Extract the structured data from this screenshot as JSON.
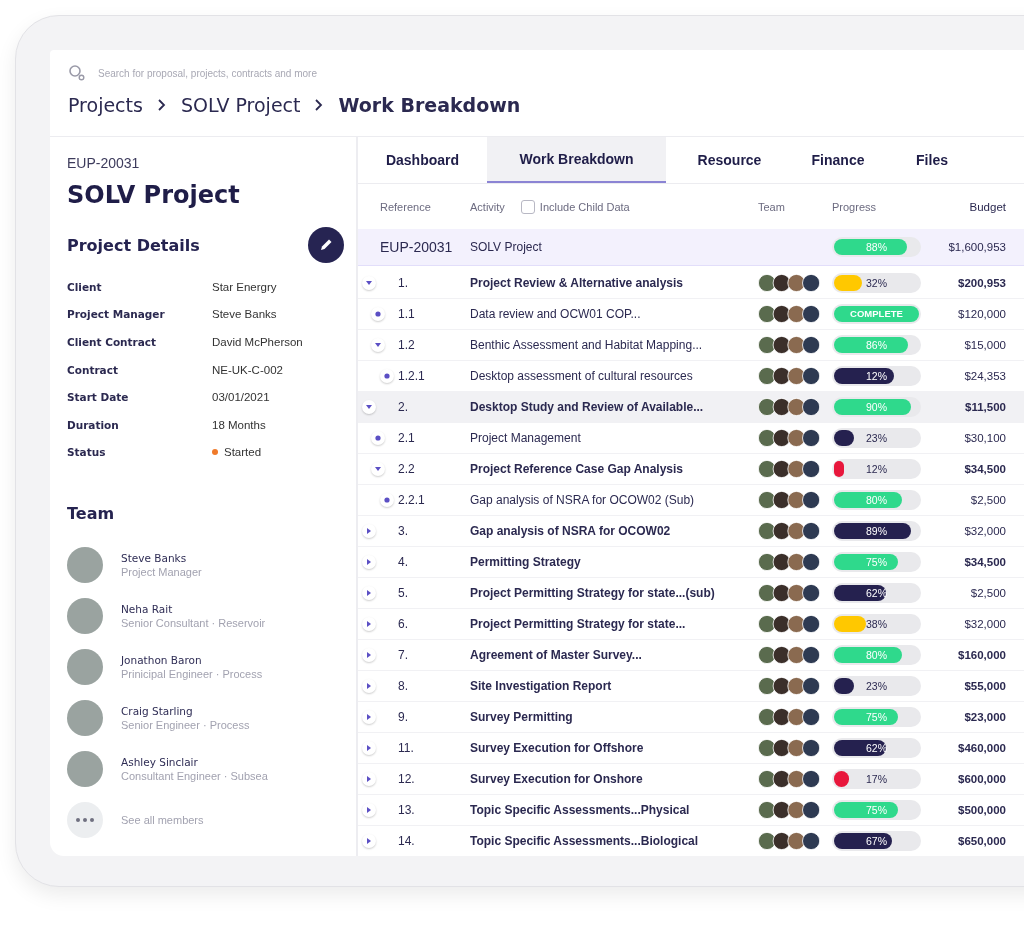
{
  "search": {
    "placeholder": "Search for proposal, projects, contracts and more"
  },
  "breadcrumb": [
    {
      "label": "Projects",
      "selected": false
    },
    {
      "label": "SOLV Project",
      "selected": false
    },
    {
      "label": "Work Breakdown",
      "selected": true
    }
  ],
  "project": {
    "reference": "EUP-20031",
    "title": "SOLV Project"
  },
  "details": {
    "title": "Project Details",
    "fields": [
      {
        "label": "Client",
        "value": "Star Energry"
      },
      {
        "label": "Project Manager",
        "value": "Steve Banks"
      },
      {
        "label": "Client Contract",
        "value": "David McPherson"
      },
      {
        "label": "Contract",
        "value": "NE-UK-C-002"
      },
      {
        "label": "Start Date",
        "value": "03/01/2021"
      },
      {
        "label": "Duration",
        "value": "18 Months"
      },
      {
        "label": "Status",
        "value": "Started",
        "color": "#f07a2a"
      }
    ]
  },
  "team": {
    "title": "Team",
    "members": [
      {
        "name": "Steve Banks",
        "role": "Project Manager"
      },
      {
        "name": "Neha Rait",
        "role": "Senior Consultant · Reservoir"
      },
      {
        "name": "Jonathon Baron",
        "role": "Prinicipal Engineer · Process"
      },
      {
        "name": "Craig Starling",
        "role": "Senior Engineer · Process"
      },
      {
        "name": "Ashley Sinclair",
        "role": "Consultant Engineer · Subsea"
      }
    ],
    "see_all": "See all members"
  },
  "tabs": [
    {
      "label": "Dashboard",
      "selected": false
    },
    {
      "label": "Work Breakdown",
      "selected": true
    },
    {
      "label": "Resource",
      "selected": false
    },
    {
      "label": "Finance",
      "selected": false
    },
    {
      "label": "Files",
      "selected": false
    }
  ],
  "table": {
    "columns": [
      "Reference",
      "Activity",
      "Team",
      "Progress",
      "Budget"
    ],
    "include_child": {
      "label": "Include Child Data",
      "checked": false
    },
    "summary": {
      "reference": "EUP-20031",
      "activity": "SOLV Project",
      "progress": {
        "label": "88%",
        "level": 0.86,
        "color": "#2fd98c"
      },
      "budget": "$1,600,953"
    },
    "rows": [
      {
        "kind": "group",
        "expanded": true,
        "selected": false,
        "reference": "1.",
        "activity": "Project Review & Alternative analysis",
        "emphasis": true,
        "progress": {
          "label": "32%",
          "level": 0.33,
          "color": "#ffc800"
        },
        "budget": "$200,953",
        "budget_emphasis": true,
        "children": [
          {
            "kind": "leaf",
            "selected": false,
            "reference": "1.1",
            "activity": "Data review and OCW01 COP...",
            "emphasis": false,
            "progress": {
              "label": "COMPLETE",
              "level": 1,
              "color": "#2fd98c"
            },
            "budget": "$120,000",
            "budget_emphasis": false
          },
          {
            "kind": "group",
            "expanded": true,
            "selected": false,
            "reference": "1.2",
            "activity": "Benthic Assessment and Habitat Mapping...",
            "emphasis": false,
            "progress": {
              "label": "86%",
              "level": 0.87,
              "color": "#2fd98c"
            },
            "budget": "$15,000",
            "budget_emphasis": false,
            "children": [
              {
                "kind": "leaf",
                "selected": false,
                "reference": "1.2.1",
                "activity": "Desktop assessment of cultural resources",
                "emphasis": false,
                "progress": {
                  "label": "12%",
                  "level": 0.7,
                  "color": "#25214f"
                },
                "budget": "$24,353",
                "budget_emphasis": false
              }
            ]
          }
        ]
      },
      {
        "kind": "group",
        "expanded": true,
        "selected": true,
        "reference": "2.",
        "activity": "Desktop Study and Review of Available...",
        "emphasis": true,
        "progress": {
          "label": "90%",
          "level": 0.91,
          "color": "#2fd98c"
        },
        "budget": "$11,500",
        "budget_emphasis": true,
        "children": [
          {
            "kind": "leaf",
            "selected": false,
            "reference": "2.1",
            "activity": "Project Management",
            "emphasis": false,
            "progress": {
              "label": "23%",
              "level": 0.24,
              "color": "#25214f"
            },
            "budget": "$30,100",
            "budget_emphasis": false
          },
          {
            "kind": "group",
            "expanded": true,
            "selected": false,
            "reference": "2.2",
            "activity": "Project Reference Case Gap Analysis",
            "emphasis": true,
            "progress": {
              "label": "12%",
              "level": 0.12,
              "color": "#e8173c"
            },
            "budget": "$34,500",
            "budget_emphasis": true,
            "children": [
              {
                "kind": "leaf",
                "selected": false,
                "reference": "2.2.1",
                "activity": "Gap analysis of NSRA for OCOW02 (Sub)",
                "emphasis": false,
                "progress": {
                  "label": "80%",
                  "level": 0.8,
                  "color": "#2fd98c"
                },
                "budget": "$2,500",
                "budget_emphasis": false
              }
            ]
          }
        ]
      },
      {
        "kind": "group",
        "expanded": false,
        "selected": false,
        "reference": "3.",
        "activity": "Gap analysis of NSRA for OCOW02",
        "emphasis": true,
        "progress": {
          "label": "89%",
          "level": 0.9,
          "color": "#25214f"
        },
        "budget": "$32,000",
        "budget_emphasis": false
      },
      {
        "kind": "group",
        "expanded": false,
        "selected": false,
        "reference": "4.",
        "activity": "Permitting Strategy",
        "emphasis": true,
        "progress": {
          "label": "75%",
          "level": 0.75,
          "color": "#2fd98c"
        },
        "budget": "$34,500",
        "budget_emphasis": true
      },
      {
        "kind": "group",
        "expanded": false,
        "selected": false,
        "reference": "5.",
        "activity": "Project Permitting Strategy for state...(sub)",
        "emphasis": true,
        "progress": {
          "label": "62%",
          "level": 0.61,
          "color": "#25214f"
        },
        "budget": "$2,500",
        "budget_emphasis": false
      },
      {
        "kind": "group",
        "expanded": false,
        "selected": false,
        "reference": "6.",
        "activity": "Project Permitting Strategy for state...",
        "emphasis": true,
        "progress": {
          "label": "38%",
          "level": 0.38,
          "color": "#ffc800"
        },
        "budget": "$32,000",
        "budget_emphasis": false
      },
      {
        "kind": "group",
        "expanded": false,
        "selected": false,
        "reference": "7.",
        "activity": "Agreement of Master Survey...",
        "emphasis": true,
        "progress": {
          "label": "80%",
          "level": 0.8,
          "color": "#2fd98c"
        },
        "budget": "$160,000",
        "budget_emphasis": true
      },
      {
        "kind": "group",
        "expanded": false,
        "selected": false,
        "reference": "8.",
        "activity": "Site Investigation Report",
        "emphasis": true,
        "progress": {
          "label": "23%",
          "level": 0.24,
          "color": "#25214f"
        },
        "budget": "$55,000",
        "budget_emphasis": true
      },
      {
        "kind": "group",
        "expanded": false,
        "selected": false,
        "reference": "9.",
        "activity": "Survey Permitting",
        "emphasis": true,
        "progress": {
          "label": "75%",
          "level": 0.75,
          "color": "#2fd98c"
        },
        "budget": "$23,000",
        "budget_emphasis": true
      },
      {
        "kind": "group",
        "expanded": false,
        "selected": false,
        "reference": "11.",
        "activity": "Survey Execution for Offshore",
        "emphasis": true,
        "progress": {
          "label": "62%",
          "level": 0.61,
          "color": "#25214f"
        },
        "budget": "$460,000",
        "budget_emphasis": true
      },
      {
        "kind": "group",
        "expanded": false,
        "selected": false,
        "reference": "12.",
        "activity": "Survey Execution for Onshore",
        "emphasis": true,
        "progress": {
          "label": "17%",
          "level": 0.18,
          "color": "#e8173c"
        },
        "budget": "$600,000",
        "budget_emphasis": true
      },
      {
        "kind": "group",
        "expanded": false,
        "selected": false,
        "reference": "13.",
        "activity": "Topic Specific Assessments...Physical",
        "emphasis": true,
        "progress": {
          "label": "75%",
          "level": 0.75,
          "color": "#2fd98c"
        },
        "budget": "$500,000",
        "budget_emphasis": true
      },
      {
        "kind": "group",
        "expanded": false,
        "selected": false,
        "reference": "14.",
        "activity": "Topic Specific Assessments...Biological",
        "emphasis": true,
        "progress": {
          "label": "67%",
          "level": 0.68,
          "color": "#25214f"
        },
        "budget": "$650,000",
        "budget_emphasis": true
      }
    ]
  }
}
